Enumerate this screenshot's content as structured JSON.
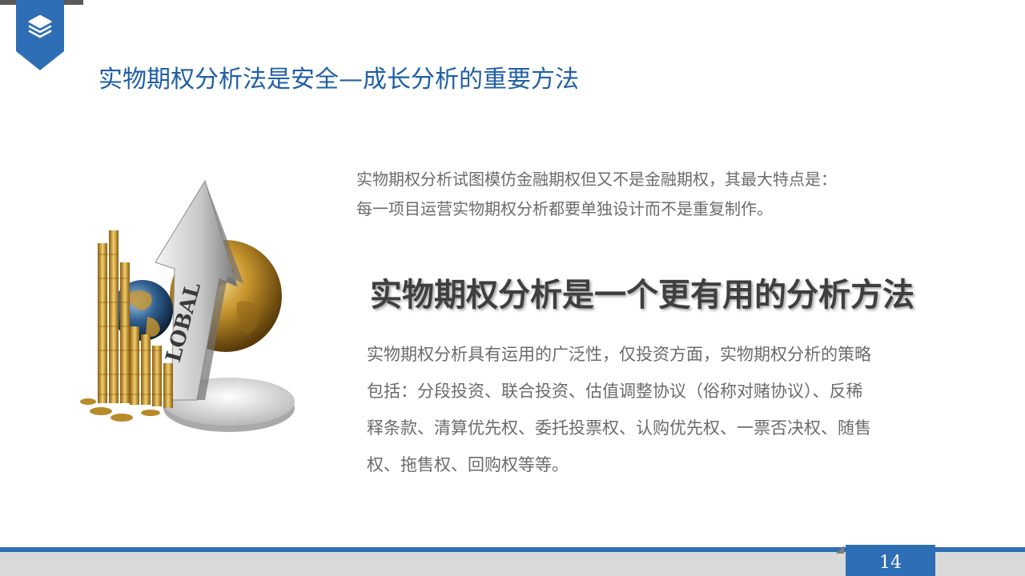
{
  "slide": {
    "title": "实物期权分析法是安全—成长分析的重要方法",
    "intro_lines": [
      "实物期权分析试图模仿金融期权但又不是金融期权，其最大特点是：",
      "每一项目运营实物期权分析都要单独设计而不是重复制作。"
    ],
    "headline": "实物期权分析是一个更有用的分析方法",
    "body_lines": [
      "实物期权分析具有运用的广泛性，仅投资方面，实物期权分析的策略",
      "包括：分段投资、联合投资、估值调整协议（俗称对赌协议）、反稀",
      "释条款、清算优先权、委托投票权、认购优先权、一票否决权、随售",
      "权、拖售权、回购权等等。"
    ],
    "illustration_text": "LOBAL",
    "page_number": "14"
  },
  "colors": {
    "accent_blue": "#2e6eb5",
    "title_blue": "#1f5fa6",
    "body_gray": "#6b6b6b",
    "footer_gray": "#d9d9d9"
  },
  "icons": {
    "badge": "layers-icon"
  }
}
